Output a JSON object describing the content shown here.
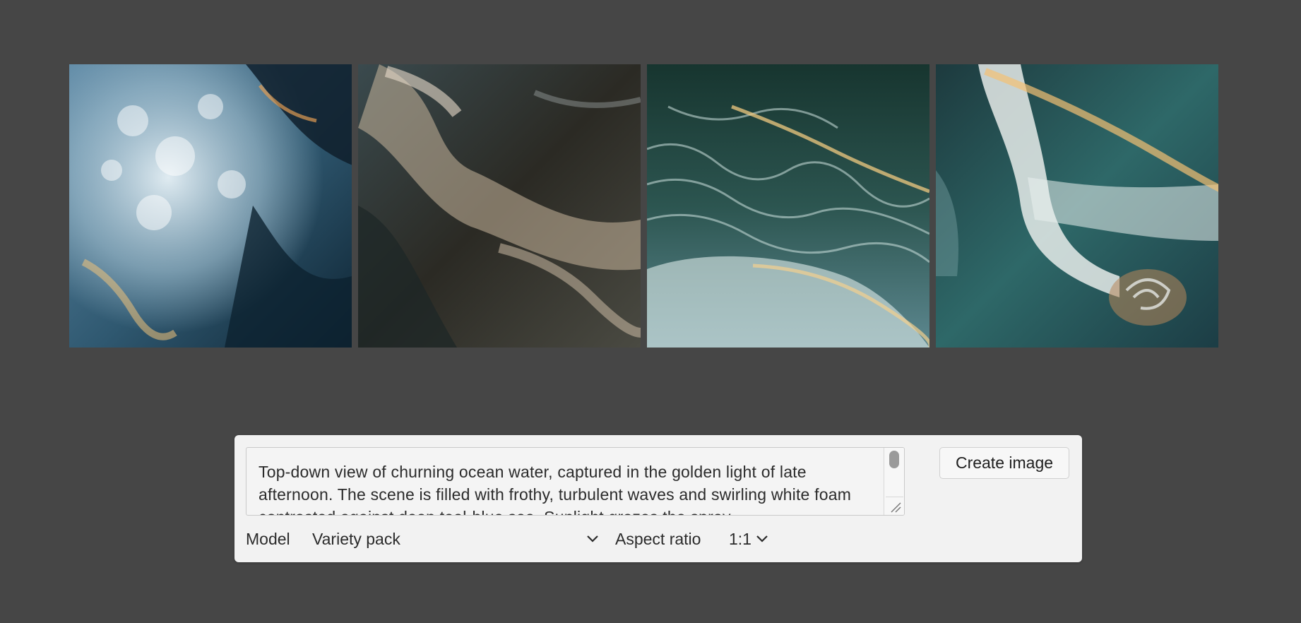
{
  "gallery": {
    "images": [
      {
        "name": "ocean-image-1"
      },
      {
        "name": "ocean-image-2"
      },
      {
        "name": "ocean-image-3"
      },
      {
        "name": "ocean-image-4"
      }
    ]
  },
  "prompt": {
    "text": "Top-down view of churning ocean water, captured in the golden light of late afternoon. The scene is filled with frothy, turbulent waves and swirling white foam contrasted against deep teal-blue sea. Sunlight grazes the spray"
  },
  "actions": {
    "create_label": "Create image"
  },
  "options": {
    "model_label": "Model",
    "model_value": "Variety pack",
    "aspect_label": "Aspect ratio",
    "aspect_value": "1:1"
  },
  "icons": {
    "model_chevron": "chevron-down-icon",
    "aspect_chevron": "chevron-down-icon",
    "resize": "resize-grip-icon"
  },
  "colors": {
    "background": "#464646",
    "panel": "#f2f2f2",
    "text": "#2b2b2b"
  }
}
